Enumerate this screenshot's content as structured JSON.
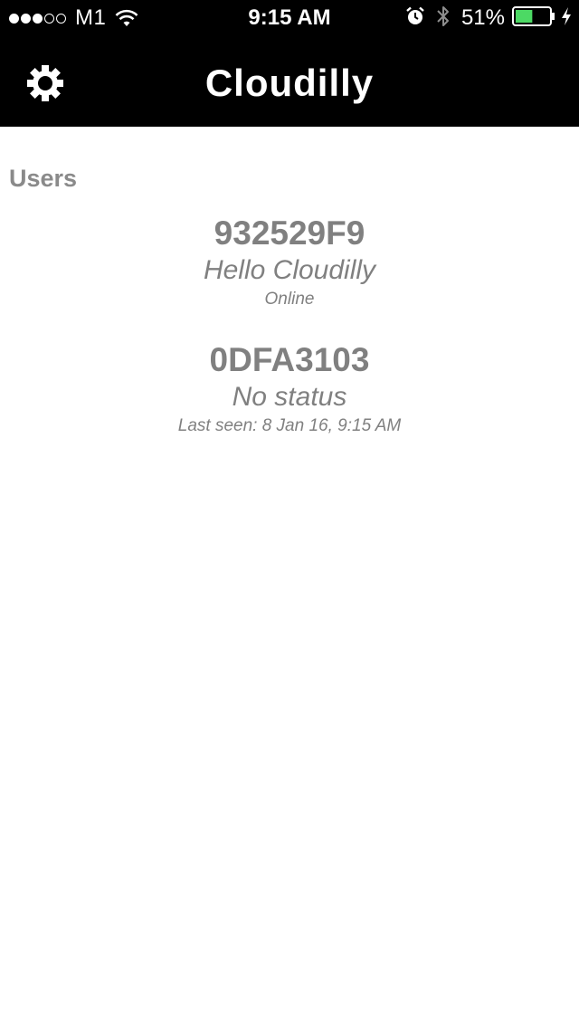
{
  "status_bar": {
    "signal_dots_filled": 3,
    "signal_dots_total": 5,
    "carrier": "M1",
    "time": "9:15 AM",
    "battery_percent_label": "51%",
    "battery_level": 0.51,
    "icons": [
      "wifi-icon",
      "alarm-icon",
      "bluetooth-icon",
      "battery-icon",
      "charging-icon"
    ]
  },
  "nav": {
    "title": "Cloudilly",
    "left_icon": "gear-icon"
  },
  "users_section": {
    "header": "Users",
    "items": [
      {
        "id": "932529F9",
        "status": "Hello Cloudilly",
        "presence": "Online"
      },
      {
        "id": "0DFA3103",
        "status": "No status",
        "presence": "Last seen: 8 Jan 16, 9:15 AM"
      }
    ]
  },
  "colors": {
    "bar_background": "#000000",
    "bar_text": "#ffffff",
    "content_text": "#808080",
    "battery_fill": "#4cd964"
  }
}
